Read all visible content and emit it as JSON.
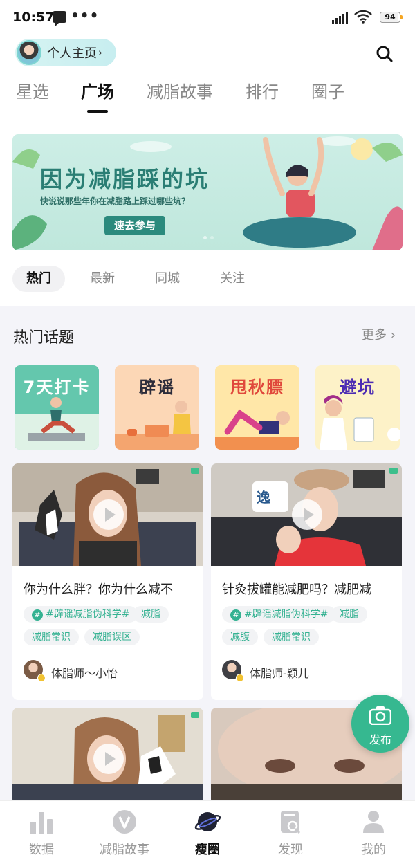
{
  "status_bar": {
    "time": "10:57",
    "dots": "•••",
    "battery": "94"
  },
  "header": {
    "profile_label": "个人主页",
    "profile_chevron": "›"
  },
  "tabs": [
    {
      "label": "星选",
      "active": false
    },
    {
      "label": "广场",
      "active": true
    },
    {
      "label": "减脂故事",
      "active": false
    },
    {
      "label": "排行",
      "active": false
    },
    {
      "label": "圈子",
      "active": false
    }
  ],
  "banner": {
    "title": "因为减脂踩的坑",
    "subtitle": "快说说那些年你在减脂路上踩过哪些坑？",
    "button": "速去参与"
  },
  "filters": [
    "热门",
    "最新",
    "同城",
    "关注"
  ],
  "hot_topics": {
    "title": "热门话题",
    "more": "更多 ›",
    "items": [
      "7天打卡",
      "辟谣",
      "甩秋膘",
      "避坑"
    ]
  },
  "cards": [
    {
      "title": "你为什么胖？你为什么减不",
      "tags": [
        "#辟谣减脂伪科学#",
        "减脂",
        "减脂常识",
        "减脂误区"
      ],
      "author": "体脂师～小怡"
    },
    {
      "title": "针灸拔罐能减肥吗？减肥减",
      "tags": [
        "#辟谣减脂伪科学#",
        "减脂",
        "减腹",
        "减脂常识"
      ],
      "author": "体脂师-颖儿"
    }
  ],
  "fab": {
    "label": "发布"
  },
  "bottom_nav": [
    {
      "label": "数据",
      "icon": "bar-chart-icon",
      "active": false
    },
    {
      "label": "减脂故事",
      "icon": "v-badge-icon",
      "active": false
    },
    {
      "label": "瘦圈",
      "icon": "planet-icon",
      "active": true
    },
    {
      "label": "发现",
      "icon": "discover-icon",
      "active": false
    },
    {
      "label": "我的",
      "icon": "person-icon",
      "active": false
    }
  ],
  "colors": {
    "accent": "#36b890",
    "tag_text": "#35b292",
    "banner_title": "#2a7e74"
  }
}
